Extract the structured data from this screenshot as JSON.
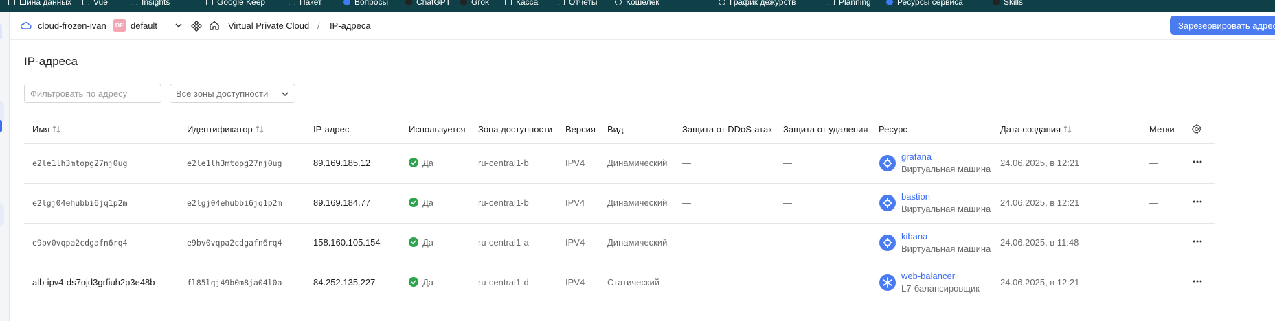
{
  "browser": {
    "bookmarks": [
      "Шина данных",
      "Vue",
      "Insights",
      "Google Keep",
      "Пакет",
      "Вопросы",
      "ChatGPT",
      "Grok",
      "Касса",
      "Отчеты",
      "Кошелек",
      "График дежурств",
      "Planning",
      "Ресурсы сервиса",
      "Skills"
    ]
  },
  "header": {
    "cloud_name": "cloud-frozen-ivan",
    "folder_badge": "DE",
    "folder_name": "default",
    "breadcrumb_service": "Virtual Private Cloud",
    "breadcrumb_separator": "/",
    "breadcrumb_current": "IP-адреса",
    "reserve_button": "Зарезервировать адрес"
  },
  "page": {
    "title": "IP-адреса",
    "filter_placeholder": "Фильтровать по адресу",
    "zone_select_value": "Все зоны доступности"
  },
  "table": {
    "columns": {
      "name": "Имя",
      "id": "Идентификатор",
      "ip": "IP-адрес",
      "used": "Используется",
      "zone": "Зона доступности",
      "version": "Версия",
      "kind": "Вид",
      "ddos": "Защита от DDoS-атак",
      "deletion": "Защита от удаления",
      "resource": "Ресурс",
      "created": "Дата создания",
      "labels": "Метки"
    },
    "rows": [
      {
        "name": "e2le1lh3mtopg27nj0ug",
        "id": "e2le1lh3mtopg27nj0ug",
        "ip": "89.169.185.12",
        "used": "Да",
        "zone": "ru-central1-b",
        "version": "IPV4",
        "kind": "Динамический",
        "ddos": "—",
        "deletion": "—",
        "resource_name": "grafana",
        "resource_type": "Виртуальная машина",
        "resource_icon": "vm-icon",
        "created": "24.06.2025, в 12:21",
        "labels": "—"
      },
      {
        "name": "e2lgj04ehubbi6jq1p2m",
        "id": "e2lgj04ehubbi6jq1p2m",
        "ip": "89.169.184.77",
        "used": "Да",
        "zone": "ru-central1-b",
        "version": "IPV4",
        "kind": "Динамический",
        "ddos": "—",
        "deletion": "—",
        "resource_name": "bastion",
        "resource_type": "Виртуальная машина",
        "resource_icon": "vm-icon",
        "created": "24.06.2025, в 12:21",
        "labels": "—"
      },
      {
        "name": "e9bv0vqpa2cdgafn6rq4",
        "id": "e9bv0vqpa2cdgafn6rq4",
        "ip": "158.160.105.154",
        "used": "Да",
        "zone": "ru-central1-a",
        "version": "IPV4",
        "kind": "Динамический",
        "ddos": "—",
        "deletion": "—",
        "resource_name": "kibana",
        "resource_type": "Виртуальная машина",
        "resource_icon": "vm-icon",
        "created": "24.06.2025, в 11:48",
        "labels": "—"
      },
      {
        "name": "alb-ipv4-ds7ojd3grfiuh2p3e48b",
        "id": "fl85lqj49b0m8ja04l0a",
        "ip": "84.252.135.227",
        "used": "Да",
        "zone": "ru-central1-d",
        "version": "IPV4",
        "kind": "Статический",
        "ddos": "—",
        "deletion": "—",
        "resource_name": "web-balancer",
        "resource_type": "L7-балансировщик",
        "resource_icon": "balancer-icon",
        "created": "24.06.2025, в 12:21",
        "labels": "—"
      }
    ]
  },
  "colors": {
    "accent": "#4a7cf0",
    "success": "#2ea44f",
    "link": "#3d6ef0",
    "bookmark_bar": "#0f3f47"
  }
}
